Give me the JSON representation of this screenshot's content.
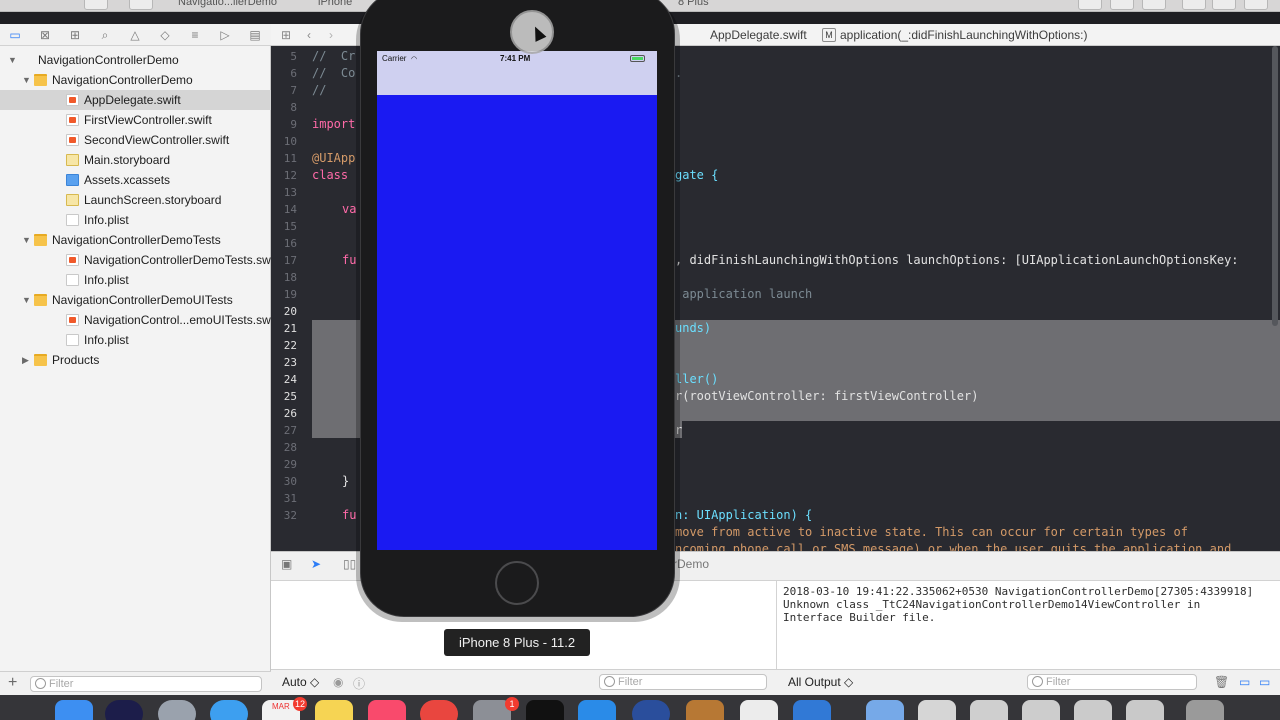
{
  "toolbar": {
    "scheme": "Navigatio...llerDemo",
    "device": "iPhone",
    "device_right": "8 Plus"
  },
  "navigator": {
    "items": [
      {
        "label": "NavigationControllerDemo",
        "kind": "project",
        "indent": 0,
        "disclosure": "▼"
      },
      {
        "label": "NavigationControllerDemo",
        "kind": "folder",
        "indent": 1,
        "disclosure": "▼"
      },
      {
        "label": "AppDelegate.swift",
        "kind": "swift",
        "indent": 2,
        "disclosure": "",
        "selected": true
      },
      {
        "label": "FirstViewController.swift",
        "kind": "swift",
        "indent": 2,
        "disclosure": ""
      },
      {
        "label": "SecondViewController.swift",
        "kind": "swift",
        "indent": 2,
        "disclosure": ""
      },
      {
        "label": "Main.storyboard",
        "kind": "story",
        "indent": 2,
        "disclosure": ""
      },
      {
        "label": "Assets.xcassets",
        "kind": "assets",
        "indent": 2,
        "disclosure": ""
      },
      {
        "label": "LaunchScreen.storyboard",
        "kind": "story",
        "indent": 2,
        "disclosure": ""
      },
      {
        "label": "Info.plist",
        "kind": "plist",
        "indent": 2,
        "disclosure": ""
      },
      {
        "label": "NavigationControllerDemoTests",
        "kind": "folder",
        "indent": 1,
        "disclosure": "▼"
      },
      {
        "label": "NavigationControllerDemoTests.swift",
        "kind": "swift",
        "indent": 2,
        "disclosure": ""
      },
      {
        "label": "Info.plist",
        "kind": "plist",
        "indent": 2,
        "disclosure": ""
      },
      {
        "label": "NavigationControllerDemoUITests",
        "kind": "folder",
        "indent": 1,
        "disclosure": "▼"
      },
      {
        "label": "NavigationControl...emoUITests.swift",
        "kind": "swift",
        "indent": 2,
        "disclosure": ""
      },
      {
        "label": "Info.plist",
        "kind": "plist",
        "indent": 2,
        "disclosure": ""
      },
      {
        "label": "Products",
        "kind": "folder",
        "indent": 1,
        "disclosure": "▶"
      }
    ],
    "filter_placeholder": "Filter"
  },
  "jumpbar": {
    "file": "AppDelegate.swift",
    "method_badge": "M",
    "method": "application(_:didFinishLaunchingWithOptions:)"
  },
  "editor": {
    "line_numbers": [
      "5",
      "6",
      "7",
      "8",
      "9",
      "10",
      "11",
      "12",
      "13",
      "14",
      "15",
      "16",
      "17",
      "18",
      "19",
      "20",
      "21",
      "22",
      "23",
      "24",
      "25",
      "26",
      "27",
      "28",
      "29",
      "30",
      "31",
      "32"
    ],
    "right_fragments": [
      ".",
      "gate {",
      ", didFinishLaunchingWithOptions launchOptions: [UIApplicationLaunchOptionsKey:",
      " application launch",
      "unds)",
      "ller()",
      "r(rootViewController: firstViewController)",
      "r",
      "n: UIApplication) {",
      "move from active to inactive state. This can occur for certain types of",
      "ncoming phone call or SMS message) or when the user quits the application and"
    ],
    "left_fragments": [
      "//  Cr",
      "//  Co",
      "//",
      "import",
      "@UIApp",
      "class ",
      "va",
      "fu",
      "}",
      "fu"
    ]
  },
  "debug": {
    "target": "llerDemo",
    "console_lines": [
      "2018-03-10 19:41:22.335062+0530 NavigationControllerDemo[27305:4339918]",
      "Unknown class _TtC24NavigationControllerDemo14ViewController in",
      "Interface Builder file."
    ],
    "auto_label": "Auto ◇",
    "all_output_label": "All Output ◇",
    "filter_placeholder": "Filter"
  },
  "simulator": {
    "carrier": "Carrier",
    "time": "7:41 PM",
    "label": "iPhone 8 Plus - 11.2",
    "screen_color": "#1a1af2",
    "statusbar_color": "#cfd0f0"
  },
  "dock": {
    "calendar_month": "MAR",
    "calendar_badge": "12",
    "app_badge": "1"
  }
}
